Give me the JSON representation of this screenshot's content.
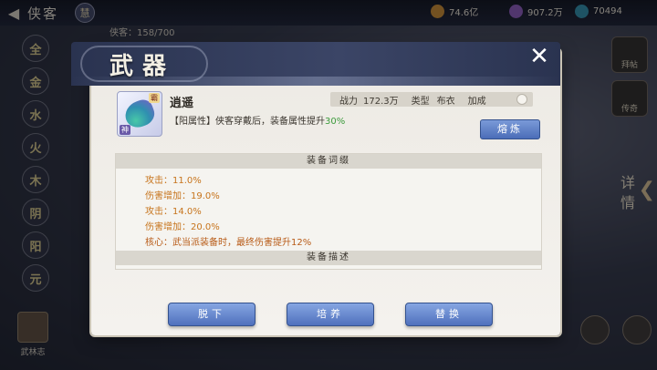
{
  "topbar": {
    "back_icon": "back-arrow-icon",
    "title": "侠客",
    "emblem": "慧",
    "resources": [
      {
        "value": "74.6亿",
        "color": "#c98a2e"
      },
      {
        "value": "907.2万",
        "color": "#8a5ab8"
      },
      {
        "value": "70494",
        "color": "#2f8fa8"
      }
    ],
    "count_label": "侠客：158/700"
  },
  "elements": [
    "全",
    "金",
    "水",
    "火",
    "木",
    "阴",
    "阳",
    "元"
  ],
  "bottom_left": {
    "label": "武林志"
  },
  "side_buttons": [
    "拜帖",
    "传奇"
  ],
  "detail_tab": "详情",
  "dialog": {
    "title": "武器",
    "close_icon": "close-icon",
    "item": {
      "name": "逍遥",
      "corner_tag": "霸",
      "bottom_tag": "神"
    },
    "stats": {
      "power_label": "战力",
      "power_value": "172.3万",
      "type_label": "类型",
      "type_value": "布衣",
      "bonus_label": "加成"
    },
    "attribute_prefix": "【阳属性】侠客穿戴后，装备属性提升",
    "attribute_value": "30%",
    "refine_button": "熔炼",
    "affix_header": "装备词缀",
    "affixes": [
      "攻击：11.0%",
      "伤害增加：19.0%",
      "攻击：14.0%",
      "伤害增加：20.0%"
    ],
    "core_affix": "核心：武当派装备时，最终伤害提升12%",
    "desc_header": "装备描述",
    "buttons": {
      "unequip": "脱下",
      "cultivate": "培养",
      "replace": "替换"
    }
  }
}
